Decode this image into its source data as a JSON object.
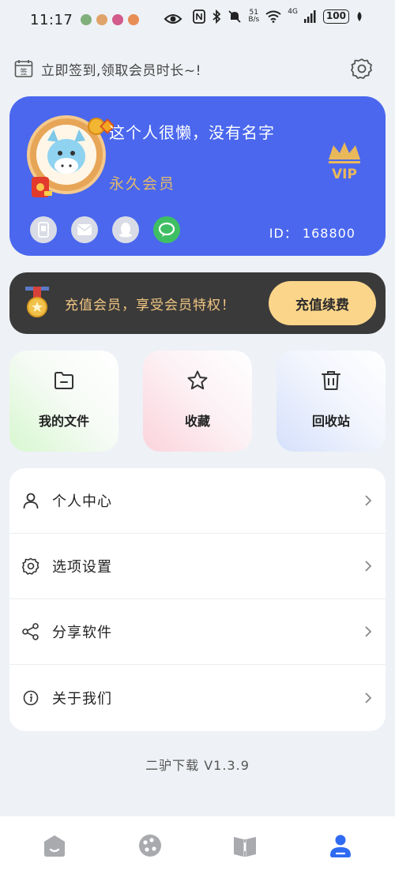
{
  "status_bar": {
    "time": "11:17",
    "net_speed_value": "51",
    "net_speed_unit": "B/s",
    "signal_label": "4G",
    "battery": "100"
  },
  "signin": {
    "text": "立即签到,领取会员时长~!",
    "icon_glyph": "签"
  },
  "profile": {
    "name": "这个人很懒，没有名字",
    "membership": "永久会员",
    "vip_badge": "VIP",
    "id_text": "ID：  168800",
    "colors": {
      "card": "#4a67ee",
      "member_text": "#e4b96b"
    }
  },
  "recharge": {
    "text": "充值会员，享受会员特权！",
    "button_label": "充值续费",
    "colors": {
      "banner": "#3b3a3a",
      "button": "#fbd58a"
    }
  },
  "quick_actions": [
    {
      "label": "我的文件",
      "icon": "folder-icon"
    },
    {
      "label": "收藏",
      "icon": "star-icon"
    },
    {
      "label": "回收站",
      "icon": "trash-icon"
    }
  ],
  "menu": [
    {
      "label": "个人中心",
      "icon": "user-icon"
    },
    {
      "label": "选项设置",
      "icon": "gear-icon"
    },
    {
      "label": "分享软件",
      "icon": "share-icon"
    },
    {
      "label": "关于我们",
      "icon": "info-icon"
    }
  ],
  "version": "二驴下载 V1.3.9",
  "bottom_nav": {
    "tabs": [
      "home-tab",
      "discover-tab",
      "books-tab",
      "mine-tab"
    ],
    "active": "mine-tab",
    "active_color": "#2f6bf2",
    "inactive_color": "#a8aaae"
  }
}
